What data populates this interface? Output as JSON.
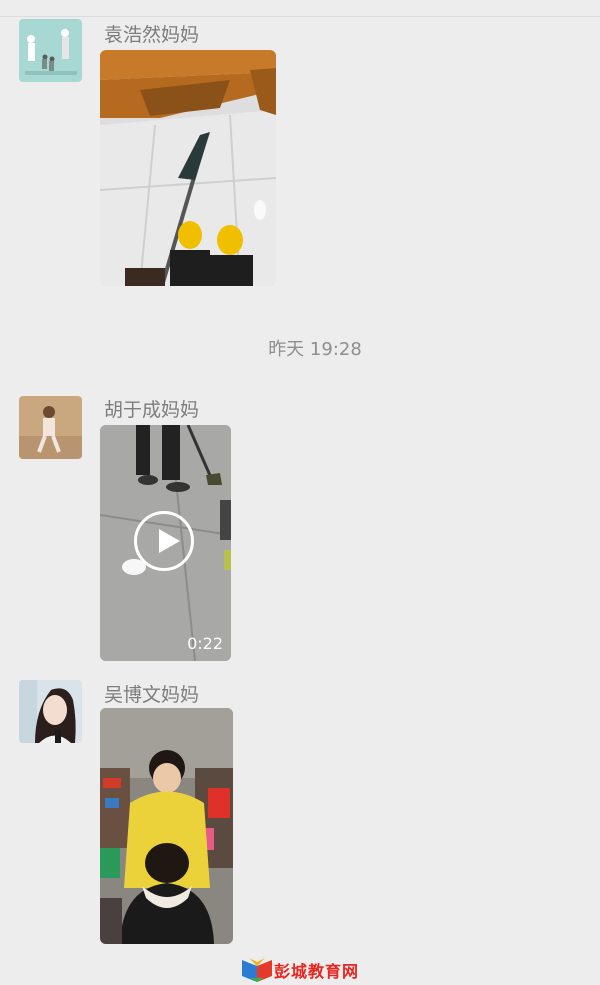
{
  "messages": [
    {
      "sender": "袁浩然妈妈",
      "type": "image"
    },
    {
      "timestamp": "昨天 19:28"
    },
    {
      "sender": "胡于成妈妈",
      "type": "video",
      "duration": "0:22"
    },
    {
      "sender": "吴博文妈妈",
      "type": "image"
    }
  ],
  "watermark": {
    "text": "彭城教育网"
  },
  "icons": [
    "play-icon",
    "book-icon"
  ]
}
